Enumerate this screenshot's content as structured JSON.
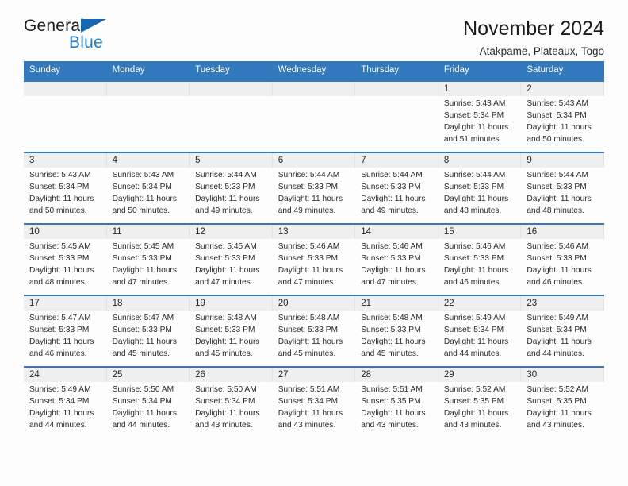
{
  "logo": {
    "text_primary": "General",
    "text_secondary": "Blue",
    "primary_color": "#1d1d1d",
    "secondary_color": "#1f7fd0",
    "triangle_color": "#1668b3"
  },
  "header": {
    "title": "November 2024",
    "subtitle": "Atakpame, Plateaux, Togo"
  },
  "theme": {
    "header_row_bg": "#3279bd",
    "header_row_text": "#ffffff",
    "daynum_band_bg": "#efefef",
    "page_bg": "#fdfdfd"
  },
  "calendar": {
    "weekday_headers": [
      "Sunday",
      "Monday",
      "Tuesday",
      "Wednesday",
      "Thursday",
      "Friday",
      "Saturday"
    ],
    "weeks": [
      [
        {
          "day": "",
          "sunrise": "",
          "sunset": "",
          "daylight_line1": "",
          "daylight_line2": ""
        },
        {
          "day": "",
          "sunrise": "",
          "sunset": "",
          "daylight_line1": "",
          "daylight_line2": ""
        },
        {
          "day": "",
          "sunrise": "",
          "sunset": "",
          "daylight_line1": "",
          "daylight_line2": ""
        },
        {
          "day": "",
          "sunrise": "",
          "sunset": "",
          "daylight_line1": "",
          "daylight_line2": ""
        },
        {
          "day": "",
          "sunrise": "",
          "sunset": "",
          "daylight_line1": "",
          "daylight_line2": ""
        },
        {
          "day": "1",
          "sunrise": "Sunrise: 5:43 AM",
          "sunset": "Sunset: 5:34 PM",
          "daylight_line1": "Daylight: 11 hours",
          "daylight_line2": "and 51 minutes."
        },
        {
          "day": "2",
          "sunrise": "Sunrise: 5:43 AM",
          "sunset": "Sunset: 5:34 PM",
          "daylight_line1": "Daylight: 11 hours",
          "daylight_line2": "and 50 minutes."
        }
      ],
      [
        {
          "day": "3",
          "sunrise": "Sunrise: 5:43 AM",
          "sunset": "Sunset: 5:34 PM",
          "daylight_line1": "Daylight: 11 hours",
          "daylight_line2": "and 50 minutes."
        },
        {
          "day": "4",
          "sunrise": "Sunrise: 5:43 AM",
          "sunset": "Sunset: 5:34 PM",
          "daylight_line1": "Daylight: 11 hours",
          "daylight_line2": "and 50 minutes."
        },
        {
          "day": "5",
          "sunrise": "Sunrise: 5:44 AM",
          "sunset": "Sunset: 5:33 PM",
          "daylight_line1": "Daylight: 11 hours",
          "daylight_line2": "and 49 minutes."
        },
        {
          "day": "6",
          "sunrise": "Sunrise: 5:44 AM",
          "sunset": "Sunset: 5:33 PM",
          "daylight_line1": "Daylight: 11 hours",
          "daylight_line2": "and 49 minutes."
        },
        {
          "day": "7",
          "sunrise": "Sunrise: 5:44 AM",
          "sunset": "Sunset: 5:33 PM",
          "daylight_line1": "Daylight: 11 hours",
          "daylight_line2": "and 49 minutes."
        },
        {
          "day": "8",
          "sunrise": "Sunrise: 5:44 AM",
          "sunset": "Sunset: 5:33 PM",
          "daylight_line1": "Daylight: 11 hours",
          "daylight_line2": "and 48 minutes."
        },
        {
          "day": "9",
          "sunrise": "Sunrise: 5:44 AM",
          "sunset": "Sunset: 5:33 PM",
          "daylight_line1": "Daylight: 11 hours",
          "daylight_line2": "and 48 minutes."
        }
      ],
      [
        {
          "day": "10",
          "sunrise": "Sunrise: 5:45 AM",
          "sunset": "Sunset: 5:33 PM",
          "daylight_line1": "Daylight: 11 hours",
          "daylight_line2": "and 48 minutes."
        },
        {
          "day": "11",
          "sunrise": "Sunrise: 5:45 AM",
          "sunset": "Sunset: 5:33 PM",
          "daylight_line1": "Daylight: 11 hours",
          "daylight_line2": "and 47 minutes."
        },
        {
          "day": "12",
          "sunrise": "Sunrise: 5:45 AM",
          "sunset": "Sunset: 5:33 PM",
          "daylight_line1": "Daylight: 11 hours",
          "daylight_line2": "and 47 minutes."
        },
        {
          "day": "13",
          "sunrise": "Sunrise: 5:46 AM",
          "sunset": "Sunset: 5:33 PM",
          "daylight_line1": "Daylight: 11 hours",
          "daylight_line2": "and 47 minutes."
        },
        {
          "day": "14",
          "sunrise": "Sunrise: 5:46 AM",
          "sunset": "Sunset: 5:33 PM",
          "daylight_line1": "Daylight: 11 hours",
          "daylight_line2": "and 47 minutes."
        },
        {
          "day": "15",
          "sunrise": "Sunrise: 5:46 AM",
          "sunset": "Sunset: 5:33 PM",
          "daylight_line1": "Daylight: 11 hours",
          "daylight_line2": "and 46 minutes."
        },
        {
          "day": "16",
          "sunrise": "Sunrise: 5:46 AM",
          "sunset": "Sunset: 5:33 PM",
          "daylight_line1": "Daylight: 11 hours",
          "daylight_line2": "and 46 minutes."
        }
      ],
      [
        {
          "day": "17",
          "sunrise": "Sunrise: 5:47 AM",
          "sunset": "Sunset: 5:33 PM",
          "daylight_line1": "Daylight: 11 hours",
          "daylight_line2": "and 46 minutes."
        },
        {
          "day": "18",
          "sunrise": "Sunrise: 5:47 AM",
          "sunset": "Sunset: 5:33 PM",
          "daylight_line1": "Daylight: 11 hours",
          "daylight_line2": "and 45 minutes."
        },
        {
          "day": "19",
          "sunrise": "Sunrise: 5:48 AM",
          "sunset": "Sunset: 5:33 PM",
          "daylight_line1": "Daylight: 11 hours",
          "daylight_line2": "and 45 minutes."
        },
        {
          "day": "20",
          "sunrise": "Sunrise: 5:48 AM",
          "sunset": "Sunset: 5:33 PM",
          "daylight_line1": "Daylight: 11 hours",
          "daylight_line2": "and 45 minutes."
        },
        {
          "day": "21",
          "sunrise": "Sunrise: 5:48 AM",
          "sunset": "Sunset: 5:33 PM",
          "daylight_line1": "Daylight: 11 hours",
          "daylight_line2": "and 45 minutes."
        },
        {
          "day": "22",
          "sunrise": "Sunrise: 5:49 AM",
          "sunset": "Sunset: 5:34 PM",
          "daylight_line1": "Daylight: 11 hours",
          "daylight_line2": "and 44 minutes."
        },
        {
          "day": "23",
          "sunrise": "Sunrise: 5:49 AM",
          "sunset": "Sunset: 5:34 PM",
          "daylight_line1": "Daylight: 11 hours",
          "daylight_line2": "and 44 minutes."
        }
      ],
      [
        {
          "day": "24",
          "sunrise": "Sunrise: 5:49 AM",
          "sunset": "Sunset: 5:34 PM",
          "daylight_line1": "Daylight: 11 hours",
          "daylight_line2": "and 44 minutes."
        },
        {
          "day": "25",
          "sunrise": "Sunrise: 5:50 AM",
          "sunset": "Sunset: 5:34 PM",
          "daylight_line1": "Daylight: 11 hours",
          "daylight_line2": "and 44 minutes."
        },
        {
          "day": "26",
          "sunrise": "Sunrise: 5:50 AM",
          "sunset": "Sunset: 5:34 PM",
          "daylight_line1": "Daylight: 11 hours",
          "daylight_line2": "and 43 minutes."
        },
        {
          "day": "27",
          "sunrise": "Sunrise: 5:51 AM",
          "sunset": "Sunset: 5:34 PM",
          "daylight_line1": "Daylight: 11 hours",
          "daylight_line2": "and 43 minutes."
        },
        {
          "day": "28",
          "sunrise": "Sunrise: 5:51 AM",
          "sunset": "Sunset: 5:35 PM",
          "daylight_line1": "Daylight: 11 hours",
          "daylight_line2": "and 43 minutes."
        },
        {
          "day": "29",
          "sunrise": "Sunrise: 5:52 AM",
          "sunset": "Sunset: 5:35 PM",
          "daylight_line1": "Daylight: 11 hours",
          "daylight_line2": "and 43 minutes."
        },
        {
          "day": "30",
          "sunrise": "Sunrise: 5:52 AM",
          "sunset": "Sunset: 5:35 PM",
          "daylight_line1": "Daylight: 11 hours",
          "daylight_line2": "and 43 minutes."
        }
      ]
    ]
  }
}
